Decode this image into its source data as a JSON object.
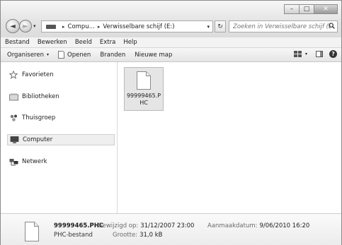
{
  "window_controls": {
    "minimize": "–",
    "maximize": "□",
    "close": "✕"
  },
  "navigation": {
    "back": "◄",
    "forward": "►",
    "history": "▾"
  },
  "address": {
    "segments": [
      "Compu...",
      "Verwisselbare schijf (E:)"
    ],
    "separator": "▸",
    "dropdown": "▾",
    "refresh": "↻"
  },
  "search": {
    "placeholder": "Zoeken in Verwisselbare schijf (E:)"
  },
  "menu": [
    "Bestand",
    "Bewerken",
    "Beeld",
    "Extra",
    "Help"
  ],
  "commands": {
    "organize": "Organiseren",
    "organize_caret": "▾",
    "open": "Openen",
    "burn": "Branden",
    "new_folder": "Nieuwe map",
    "views_caret": "▾",
    "help": "?"
  },
  "sidebar": {
    "items": [
      {
        "label": "Favorieten",
        "icon": "star-icon"
      },
      {
        "label": "Bibliotheken",
        "icon": "library-icon"
      },
      {
        "label": "Thuisgroep",
        "icon": "homegroup-icon"
      },
      {
        "label": "Computer",
        "icon": "computer-icon",
        "selected": true
      },
      {
        "label": "Netwerk",
        "icon": "network-icon"
      }
    ]
  },
  "files": [
    {
      "name": "99999465.PHC",
      "selected": true
    }
  ],
  "details": {
    "name": "99999465.PHC",
    "type": "PHC-bestand",
    "modified_label": "Gewijzigd op:",
    "modified_value": "31/12/2007 23:00",
    "size_label": "Grootte:",
    "size_value": "31,0 kB",
    "created_label": "Aanmaakdatum:",
    "created_value": "9/06/2010 16:20"
  }
}
